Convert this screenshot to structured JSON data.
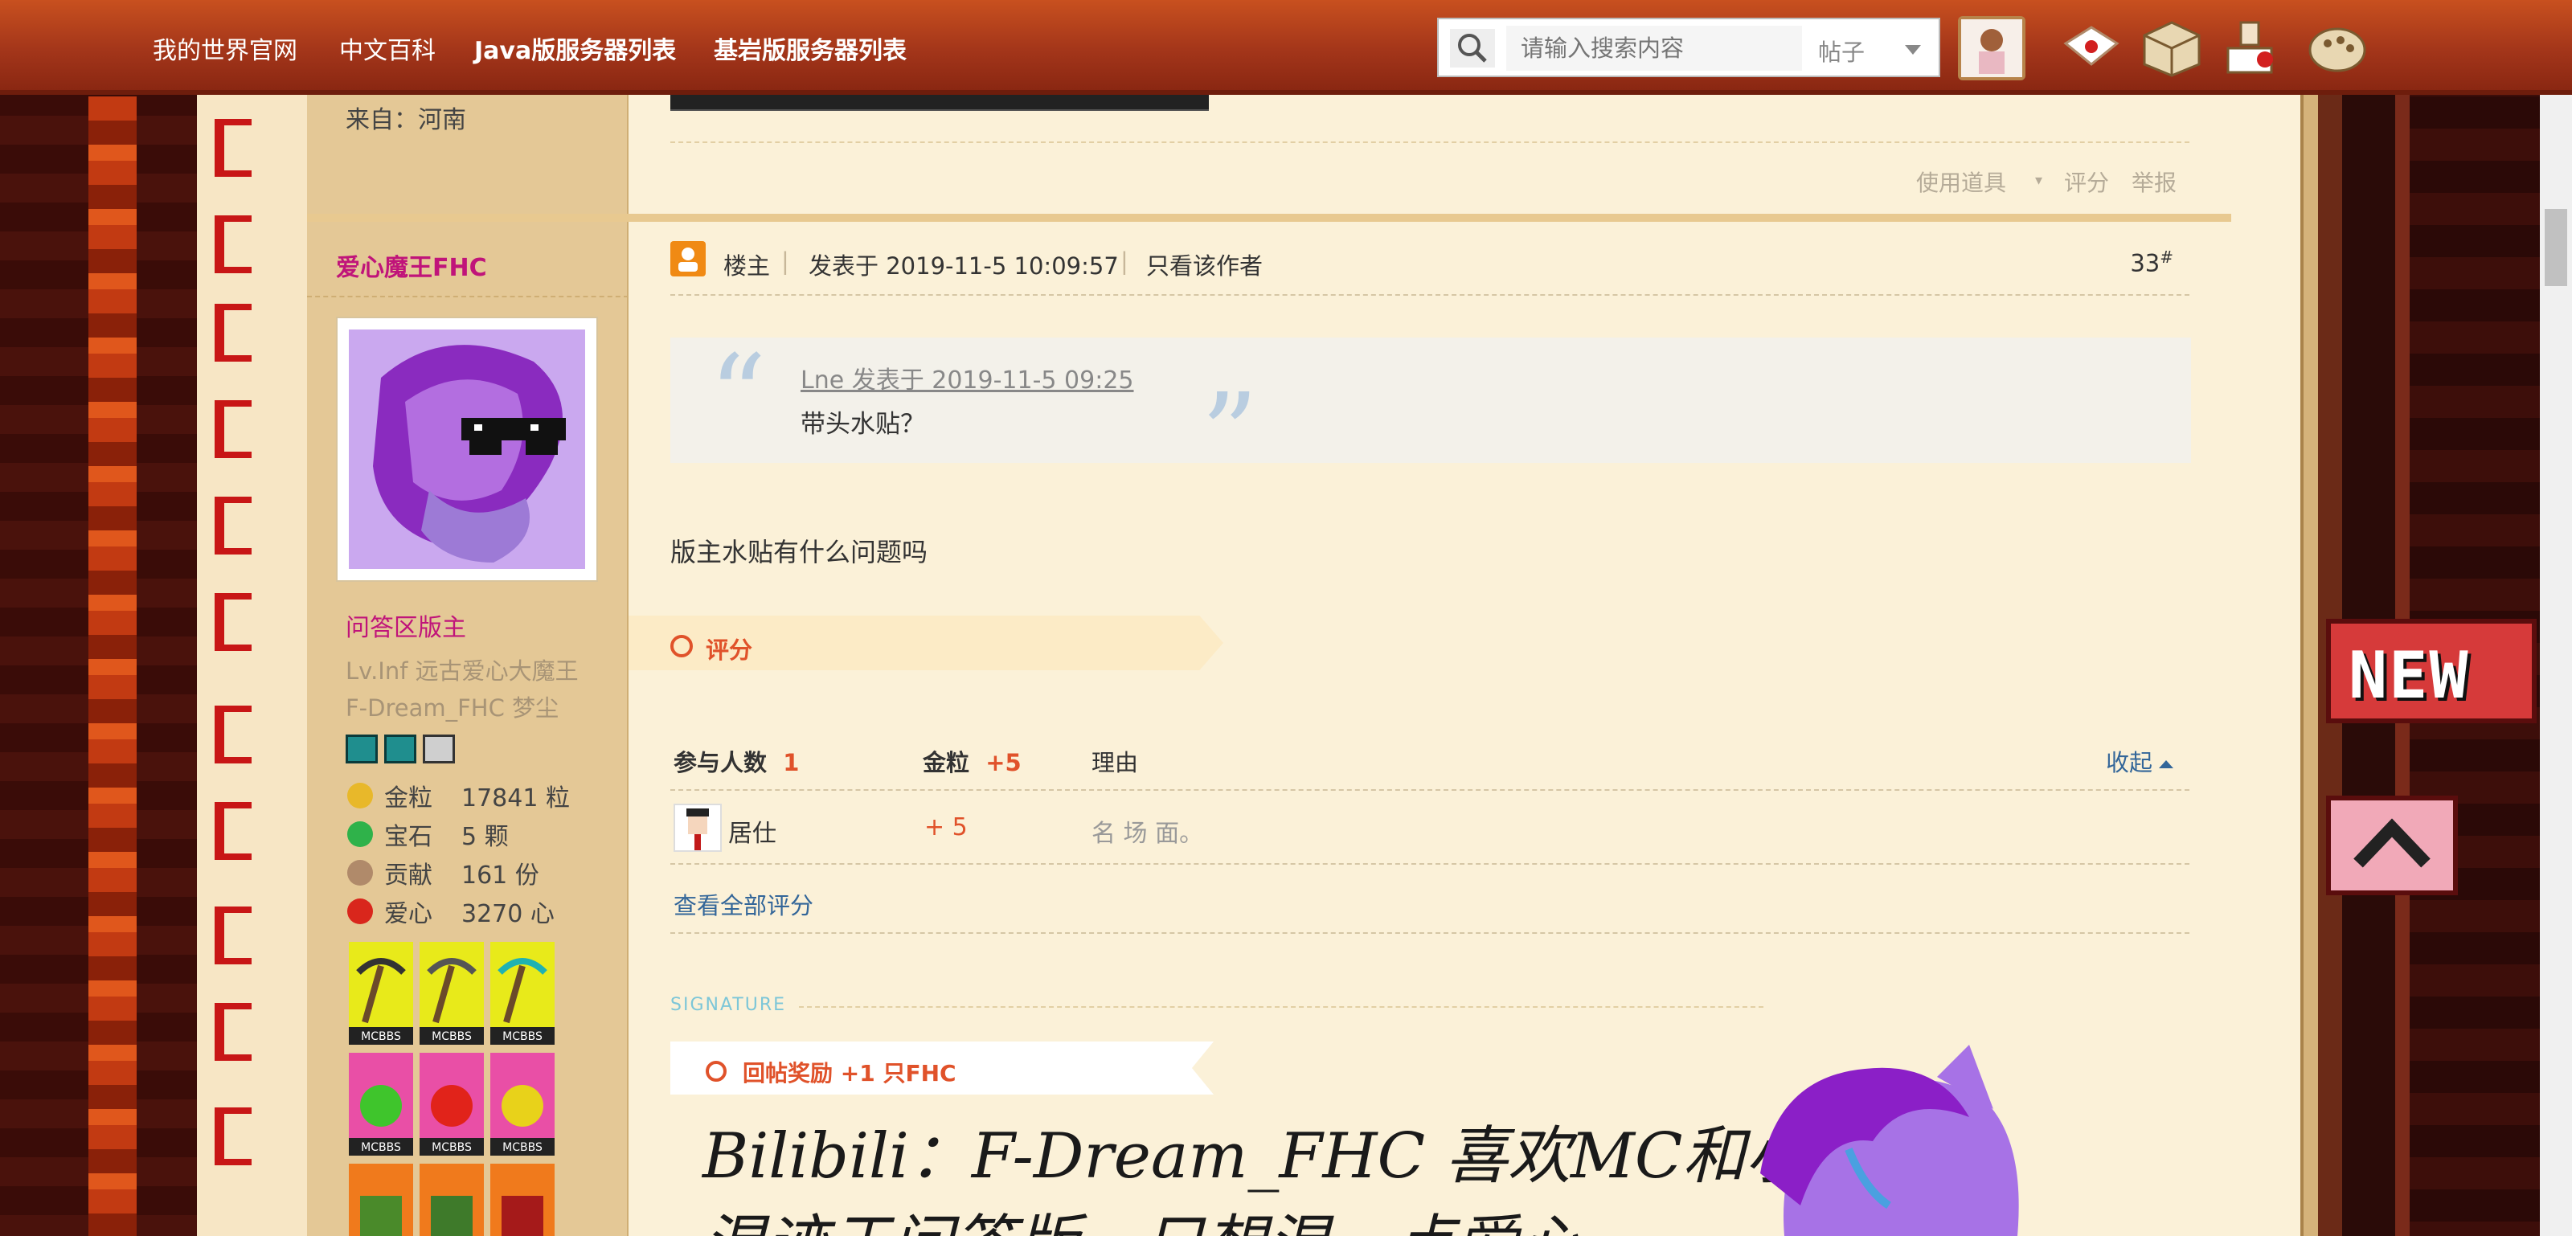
{
  "nav": {
    "items": [
      "我的世界官网",
      "中文百科",
      "Java版服务器列表",
      "基岩版服务器列表"
    ]
  },
  "search": {
    "placeholder": "请输入搜索内容",
    "scope": "帖子"
  },
  "prev_post": {
    "from": "来自：河南",
    "actions": [
      "使用道具",
      "评分",
      "举报"
    ]
  },
  "author": {
    "name": "爱心魔王FHC",
    "role": "问答区版主",
    "level": "Lv.Inf 远古爱心大魔王",
    "title": "F-Dream_FHC 梦尘",
    "stats": [
      {
        "icon": "gold-nugget-icon",
        "label": "金粒",
        "value": "17841 粒",
        "color": "#e8b82a"
      },
      {
        "icon": "emerald-icon",
        "label": "宝石",
        "value": "5 颗",
        "color": "#2fb24a"
      },
      {
        "icon": "contribution-icon",
        "label": "贡献",
        "value": "161 份",
        "color": "#b08a6a"
      },
      {
        "icon": "heart-icon",
        "label": "爱心",
        "value": "3270 心",
        "color": "#d9261c"
      }
    ],
    "medal_label": "MCBBS"
  },
  "post": {
    "owner_label": "楼主",
    "posted_at": "发表于 2019-11-5 10:09:57",
    "author_only": "只看该作者",
    "floor": "33",
    "floor_mark": "#",
    "quote_meta": "Lne 发表于 2019-11-5 09:25",
    "quote_text": "带头水贴？",
    "body": "版主水贴有什么问题吗"
  },
  "rating": {
    "title": "评分",
    "participants_label": "参与人数",
    "participants": "1",
    "gold_label": "金粒",
    "gold_total": "+5",
    "reason_label": "理由",
    "collapse": "收起",
    "rows": [
      {
        "user": "居仕",
        "gold": "+ 5",
        "reason": "名 场 面。"
      }
    ],
    "view_all": "查看全部评分"
  },
  "signature": {
    "label": "SIGNATURE",
    "reward": "回帖奖励 +1 只FHC",
    "line1": "Bilibili：F-Dream_FHC  喜欢MC和小马",
    "line2": "混迹于问答版，只想混一点爱心"
  },
  "widgets": {
    "new_label": "NEW"
  },
  "colors": {
    "nav_bg": "#b2401b",
    "author_name": "#c0147a",
    "accent_orange": "#e0522a",
    "link_blue": "#336699"
  }
}
